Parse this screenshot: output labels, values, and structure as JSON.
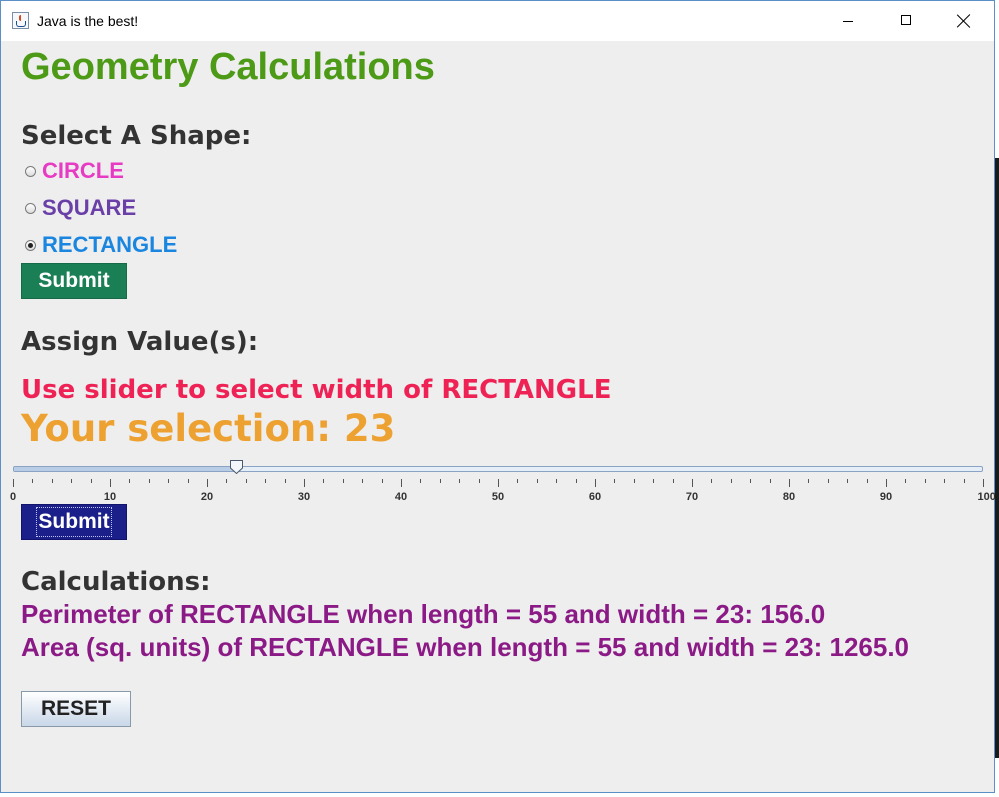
{
  "window": {
    "title": "Java is the best!"
  },
  "app": {
    "heading": "Geometry Calculations",
    "select_label": "Select A Shape:",
    "shapes": [
      {
        "label": "CIRCLE",
        "color": "#e83bc4",
        "checked": false
      },
      {
        "label": "SQUARE",
        "color": "#6a3fa8",
        "checked": false
      },
      {
        "label": "RECTANGLE",
        "color": "#1a86e0",
        "checked": true
      }
    ],
    "submit1_label": "Submit",
    "assign_label": "Assign Value(s):",
    "instruction": "Use slider to select width of RECTANGLE",
    "selection_text": "Your selection: 23",
    "slider": {
      "value": 23,
      "min": 0,
      "max": 100,
      "tick_labels": [
        "0",
        "10",
        "20",
        "30",
        "40",
        "50",
        "60",
        "70",
        "80",
        "90",
        "100"
      ]
    },
    "submit2_label": "Submit",
    "calc_label": "Calculations:",
    "perimeter_text": "Perimeter of RECTANGLE when length = 55 and width = 23: 156.0",
    "area_text": "Area (sq. units) of RECTANGLE when length = 55 and width = 23: 1265.0",
    "reset_label": "RESET"
  }
}
